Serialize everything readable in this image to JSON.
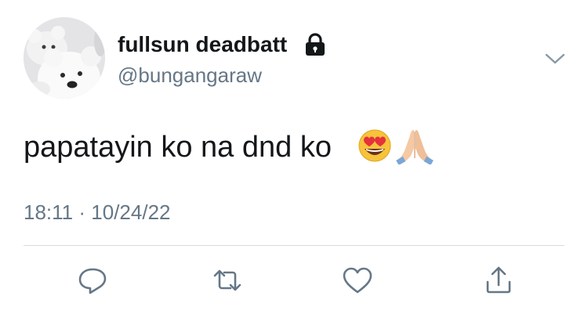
{
  "tweet": {
    "display_name": "fullsun deadbatt",
    "handle": "@bungangaraw",
    "text": "papatayin ko na dnd ko",
    "emojis": [
      "heart-eyes-emoji",
      "folded-hands-emoji"
    ],
    "time": "18:11",
    "separator": "·",
    "date": "10/24/22",
    "protected": true
  },
  "actions": [
    {
      "name": "reply",
      "icon": "reply-icon"
    },
    {
      "name": "retweet",
      "icon": "retweet-icon"
    },
    {
      "name": "like",
      "icon": "heart-icon"
    },
    {
      "name": "share",
      "icon": "share-icon"
    }
  ],
  "colors": {
    "text": "#14171a",
    "secondary": "#657786",
    "divider": "#d5dbe0",
    "icon": "#657786"
  }
}
